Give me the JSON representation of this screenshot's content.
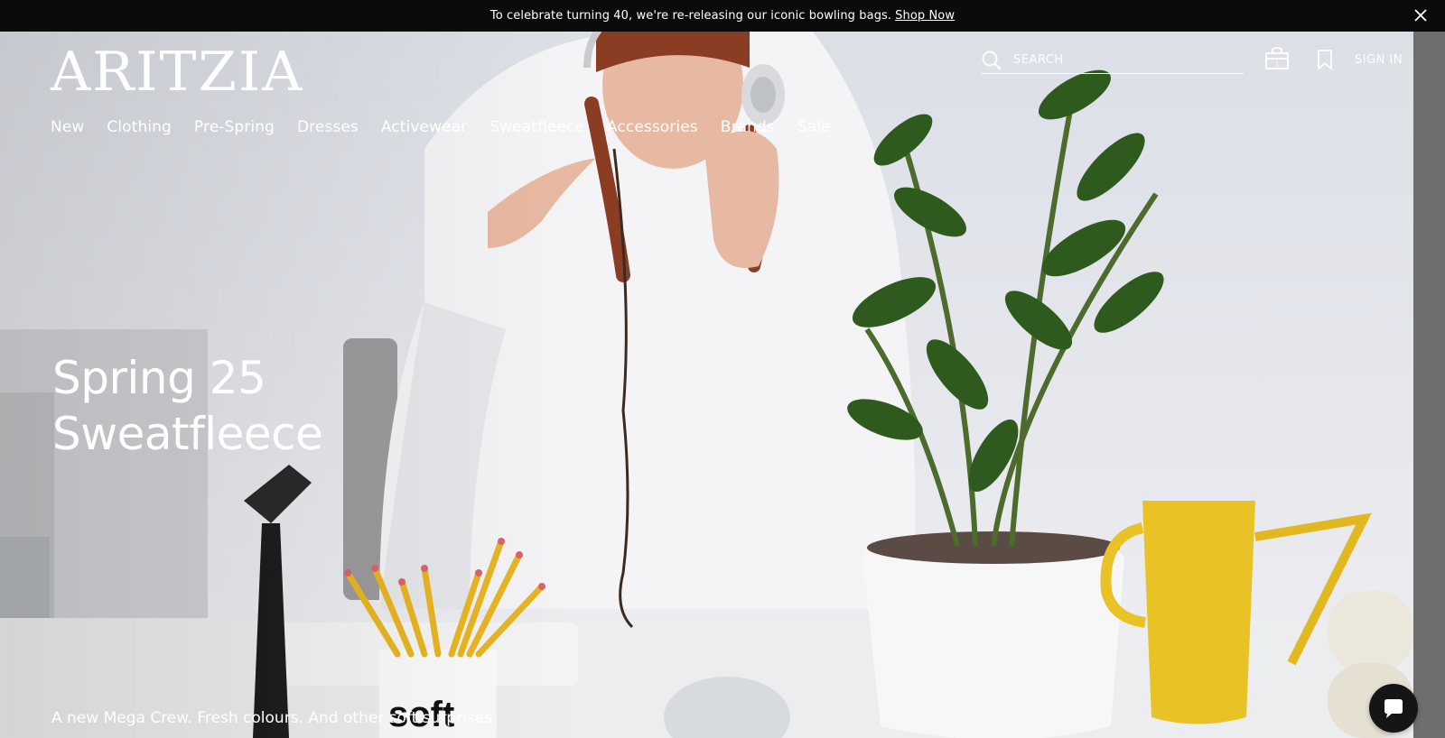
{
  "announcement": {
    "message": "To celebrate turning 40, we're re-releasing our iconic bowling bags.",
    "link_label": "Shop Now"
  },
  "header": {
    "logo": "ARITZIA",
    "search_placeholder": "SEARCH",
    "cart_count": "1",
    "sign_in": "SIGN IN"
  },
  "nav": {
    "items": [
      "New",
      "Clothing",
      "Pre-Spring",
      "Dresses",
      "Activewear",
      "Sweatfleece",
      "Accessories",
      "Brands",
      "Sale"
    ]
  },
  "hero": {
    "title_line1": "Spring 25",
    "title_line2": "Sweatfleece",
    "subtitle": "A new Mega Crew. Fresh colours. And other soft surprises.",
    "mug_text": "soft"
  },
  "colors": {
    "announcement_bg": "#0b0b0b",
    "text_on_hero": "#ffffff",
    "chat_button": "#151515"
  },
  "icons": [
    "close-icon",
    "search-icon",
    "shopping-bag-icon",
    "bookmark-icon",
    "chat-icon"
  ]
}
